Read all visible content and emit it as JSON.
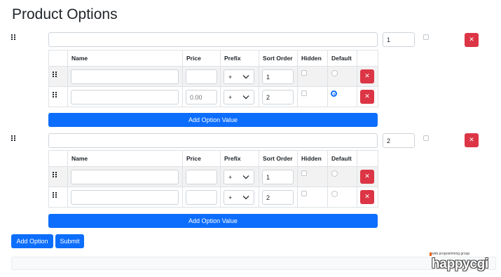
{
  "page": {
    "title": "Product Options"
  },
  "table_headers": {
    "name": "Name",
    "price": "Price",
    "prefix": "Prefix",
    "sort_order": "Sort Order",
    "hidden": "Hidden",
    "default": "Default"
  },
  "options": [
    {
      "name_value": "",
      "sort_order": "1",
      "hidden": false,
      "values": [
        {
          "name": "",
          "price": "",
          "price_placeholder": "",
          "prefix": "+",
          "sort_order": "1",
          "hidden": false,
          "default": false
        },
        {
          "name": "",
          "price": "",
          "price_placeholder": "0.00",
          "prefix": "+",
          "sort_order": "2",
          "hidden": false,
          "default": true
        }
      ]
    },
    {
      "name_value": "",
      "sort_order": "2",
      "hidden": false,
      "values": [
        {
          "name": "",
          "price": "",
          "price_placeholder": "",
          "prefix": "+",
          "sort_order": "1",
          "hidden": false,
          "default": false
        },
        {
          "name": "",
          "price": "",
          "price_placeholder": "",
          "prefix": "+",
          "sort_order": "2",
          "hidden": false,
          "default": false
        }
      ]
    }
  ],
  "buttons": {
    "delete_glyph": "✕",
    "add_option_value": "Add Option Value",
    "add_option": "Add Option",
    "submit": "Submit"
  },
  "branding": {
    "tagline": "web programming group",
    "logo_text": "happycgi"
  },
  "colors": {
    "primary": "#0d6efd",
    "danger": "#dc3545"
  },
  "icons": {
    "drag": "drag-handle-icon",
    "delete": "close-icon",
    "select": "chevron-down-icon"
  }
}
